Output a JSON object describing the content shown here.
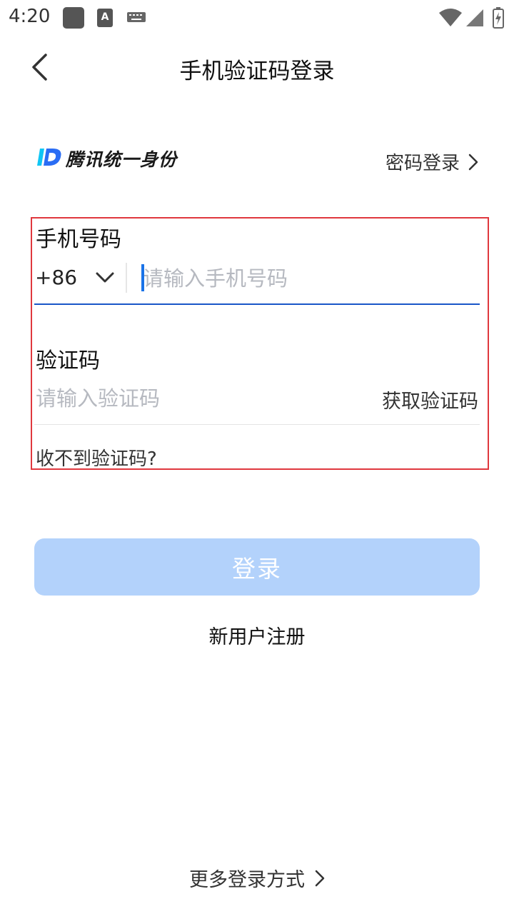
{
  "status_bar": {
    "time": "4:20",
    "icons": [
      "app-square-icon",
      "a-font-icon",
      "keyboard-icon",
      "wifi-icon",
      "signal-icon",
      "battery-charging-icon"
    ]
  },
  "nav": {
    "title": "手机验证码登录",
    "back_icon": "chevron-left-icon"
  },
  "brand": {
    "name": "腾讯统一身份",
    "logo_colors": [
      "#2a6df4",
      "#10c6f4"
    ],
    "password_login": "密码登录"
  },
  "form": {
    "phone_label": "手机号码",
    "country_code": "+86",
    "phone_placeholder": "请输入手机号码",
    "phone_value": "",
    "code_label": "验证码",
    "code_placeholder": "请输入验证码",
    "code_value": "",
    "get_code": "获取验证码",
    "no_code": "收不到验证码?"
  },
  "actions": {
    "login": "登录",
    "register": "新用户注册",
    "more_login": "更多登录方式"
  },
  "colors": {
    "accent": "#1a56c8",
    "login_btn_disabled": "#b3d2fb",
    "highlight_border": "#e0383e"
  }
}
